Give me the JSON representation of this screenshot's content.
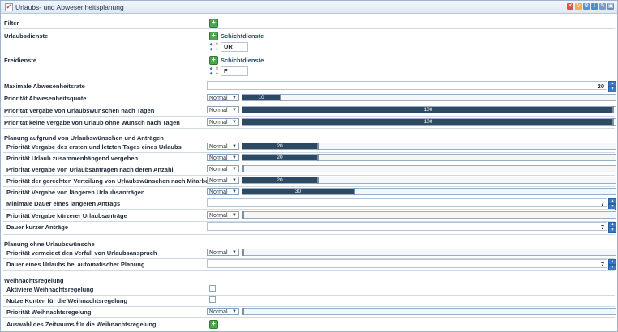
{
  "window": {
    "title": "Urlaubs- und Abwesenheitsplanung"
  },
  "filter": {
    "label": "Filter"
  },
  "urlaubsdienste": {
    "label": "Urlaubsdienste",
    "link": "Schichtdienste",
    "value": "UR"
  },
  "freidienste": {
    "label": "Freidienste",
    "link": "Schichtdienste",
    "value": "F"
  },
  "max_abwesenheitsrate": {
    "label": "Maximale Abwesenheitsrate",
    "value": "20"
  },
  "prio_abwesenheitsquote": {
    "label": "Priorität Abwesenheitsquote",
    "select": "Normal",
    "value": "10",
    "level": 10
  },
  "prio_vergabe_wuensche": {
    "label": "Priorität Vergabe von Urlaubswünschen nach Tagen",
    "select": "Normal",
    "value": "100",
    "level": 100
  },
  "prio_keine_vergabe": {
    "label": "Priorität keine Vergabe von Urlaub ohne Wunsch nach Tagen",
    "select": "Normal",
    "value": "100",
    "level": 100
  },
  "section_planung": "Planung aufgrund von Urlaubswünschen und Anträgen",
  "planung_items": [
    {
      "label": "Priorität Vergabe des ersten und letzten Tages eines Urlaubs",
      "select": "Normal",
      "value": "20",
      "level": 20
    },
    {
      "label": "Priorität Urlaub zusammenhängend vergeben",
      "select": "Normal",
      "value": "20",
      "level": 20
    },
    {
      "label": "Priorität Vergabe von Urlaubsanträgen nach deren Anzahl",
      "select": "Normal",
      "value": "",
      "level": 0
    },
    {
      "label": "Priorität der gerechten Verteilung von Urlaubswünschen nach Mitarbeitern",
      "select": "Normal",
      "value": "20",
      "level": 20
    },
    {
      "label": "Priorität Vergabe von längeren Urlaubsanträgen",
      "select": "Normal",
      "value": "30",
      "level": 30
    }
  ],
  "minimale_dauer": {
    "label": "Minimale Dauer eines längeren Antrags",
    "value": "7"
  },
  "prio_kuerzer": {
    "label": "Priorität Vergabe kürzerer Urlaubsanträge",
    "select": "Normal",
    "value": "",
    "level": 0
  },
  "dauer_kurzer": {
    "label": "Dauer kurzer Anträge",
    "value": "7"
  },
  "section_ohne": "Planung ohne Urlaubswünsche",
  "prio_verfall": {
    "label": "Priorität vermeidet den Verfall von Urlaubsanspruch",
    "select": "Normal",
    "value": "",
    "level": 0
  },
  "dauer_automatisch": {
    "label": "Dauer eines Urlaubs bei automatischer Planung",
    "value": "7"
  },
  "section_weihnacht": "Weihnachtsregelung",
  "aktiviere_weihnacht": {
    "label": "Aktiviere Weihnachtsregelung",
    "checked": false
  },
  "nutze_konten": {
    "label": "Nutze Konten für die Weihnachtsregelung",
    "checked": false
  },
  "prio_weihnacht": {
    "label": "Priorität Weihnachtsregelung",
    "select": "Normal",
    "value": "",
    "level": 0
  },
  "auswahl_zeitraum": {
    "label": "Auswahl des Zeitraums für die Weihnachtsregelung"
  },
  "icons": {
    "title_checkbox": "checkbox-icon",
    "toolbar": [
      "close-red-icon",
      "refresh-icon",
      "settings-icon",
      "export-icon",
      "edit-icon",
      "save-icon"
    ],
    "add": "plus-icon",
    "spin": "spin-arrows-icon",
    "dropdown": "chevron-down-icon"
  },
  "colors": {
    "slider_fill": "#2c4a63",
    "add_green": "#4ca84c",
    "spin_blue": "#3a79c9",
    "link": "#1f4a7c"
  }
}
